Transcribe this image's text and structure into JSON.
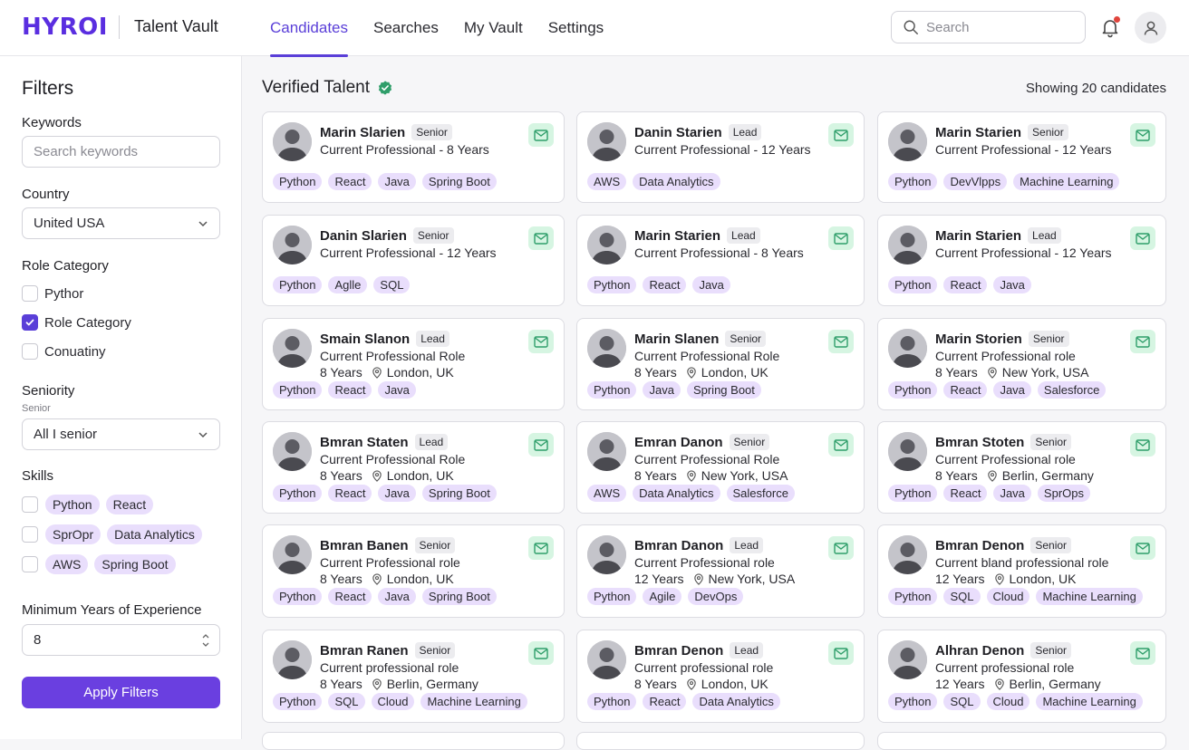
{
  "header": {
    "logo": "HYROI",
    "app_title": "Talent Vault",
    "tabs": [
      {
        "label": "Candidates",
        "active": true
      },
      {
        "label": "Searches",
        "active": false
      },
      {
        "label": "My Vault",
        "active": false
      },
      {
        "label": "Settings",
        "active": false
      }
    ],
    "search_placeholder": "Search",
    "icons": {
      "search": "search-icon",
      "bell": "bell-icon",
      "user": "user-icon"
    },
    "accent_color": "#5a3fd8",
    "notification_dot_color": "#e0443c"
  },
  "filters": {
    "title": "Filters",
    "keywords_label": "Keywords",
    "keywords_placeholder": "Search keywords",
    "country_label": "Country",
    "country_value": "United USA",
    "role_category_label": "Role Category",
    "role_options": [
      {
        "label": "Pythor",
        "checked": false
      },
      {
        "label": "Role Category",
        "checked": true
      },
      {
        "label": "Conuatiny",
        "checked": false
      }
    ],
    "seniority_label": "Seniority",
    "seniority_sublabel": "Senior",
    "seniority_value": "All I senior",
    "skills_label": "Skills",
    "skill_rows": [
      {
        "checked": false,
        "tags": [
          "Python",
          "React"
        ]
      },
      {
        "checked": false,
        "tags": [
          "SprOpr",
          "Data Analytics"
        ]
      },
      {
        "checked": false,
        "tags": [
          "AWS",
          "Spring Boot"
        ]
      }
    ],
    "min_years_label": "Minimum Years of Experience",
    "min_years_value": "8",
    "apply_label": "Apply Filters",
    "button_color": "#6a3fe0"
  },
  "main": {
    "title": "Verified Talent",
    "verified_color": "#2f9e6a",
    "count_text": "Showing 20 candidates",
    "tag_color": "#e9defc",
    "mail_bg_color": "#d6f5e2",
    "candidates": [
      {
        "name": "Marin Slarien",
        "level": "Senior",
        "role": "Current Professional  - 8 Years",
        "years": "",
        "location": "",
        "tags": [
          "Python",
          "React",
          "Java",
          "Spring Boot"
        ]
      },
      {
        "name": "Danin Starien",
        "level": "Lead",
        "role": "Current Professional - 12 Years",
        "years": "",
        "location": "",
        "tags": [
          "AWS",
          "Data Analytics"
        ]
      },
      {
        "name": "Marin Starien",
        "level": "Senior",
        "role": "Current Professional - 12 Years",
        "years": "",
        "location": "",
        "tags": [
          "Python",
          "DevVlpps",
          "Machine Learning"
        ]
      },
      {
        "name": "Danin Slarien",
        "level": "Senior",
        "role": "Current Professional - 12 Years",
        "years": "",
        "location": "",
        "tags": [
          "Python",
          "Aglle",
          "SQL"
        ]
      },
      {
        "name": "Marin Starien",
        "level": "Lead",
        "role": "Current Professional - 8 Years",
        "years": "",
        "location": "",
        "tags": [
          "Python",
          "React",
          "Java"
        ]
      },
      {
        "name": "Marin Starien",
        "level": "Lead",
        "role": "Current Professional - 12 Years",
        "years": "",
        "location": "",
        "tags": [
          "Python",
          "React",
          "Java"
        ]
      },
      {
        "name": "Smain Slanon",
        "level": "Lead",
        "role": "Current Professional Role",
        "years": "8 Years",
        "location": "London, UK",
        "tags": [
          "Python",
          "React",
          "Java"
        ]
      },
      {
        "name": "Marin Slanen",
        "level": "Senior",
        "role": "Current Professional Role",
        "years": "8 Years",
        "location": "London, UK",
        "tags": [
          "Python",
          "Java",
          "Spring Boot"
        ]
      },
      {
        "name": "Marin Storien",
        "level": "Senior",
        "role": "Current Professional role",
        "years": "8 Years",
        "location": "New York, USA",
        "tags": [
          "Python",
          "React",
          "Java",
          "Salesforce"
        ]
      },
      {
        "name": "Bmran Staten",
        "level": "Lead",
        "role": "Current Professional Role",
        "years": "8 Years",
        "location": "London, UK",
        "tags": [
          "Python",
          "React",
          "Java",
          "Spring Boot"
        ]
      },
      {
        "name": "Emran Danon",
        "level": "Senior",
        "role": "Current Professional Role",
        "years": "8 Years",
        "location": "New York, USA",
        "tags": [
          "AWS",
          "Data Analytics",
          "Salesforce"
        ]
      },
      {
        "name": "Bmran Stoten",
        "level": "Senior",
        "role": "Current Professional role",
        "years": "8 Years",
        "location": "Berlin, Germany",
        "tags": [
          "Python",
          "React",
          "Java",
          "SprOps"
        ]
      },
      {
        "name": "Bmran Banen",
        "level": "Senior",
        "role": "Current Professional role",
        "years": "8 Years",
        "location": "London, UK",
        "tags": [
          "Python",
          "React",
          "Java",
          "Spring Boot"
        ]
      },
      {
        "name": "Bmran Danon",
        "level": "Lead",
        "role": "Current Professional role",
        "years": "12 Years",
        "location": "New York, USA",
        "tags": [
          "Python",
          "Agile",
          "DevOps"
        ]
      },
      {
        "name": "Bmran Denon",
        "level": "Senior",
        "role": "Current bland professional role",
        "years": "12 Years",
        "location": "London, UK",
        "tags": [
          "Python",
          "SQL",
          "Cloud",
          "Machine Learning"
        ]
      },
      {
        "name": "Bmran Ranen",
        "level": "Senior",
        "role": "Current professional role",
        "years": "8 Years",
        "location": "Berlin, Germany",
        "tags": [
          "Python",
          "SQL",
          "Cloud",
          "Machine Learning"
        ]
      },
      {
        "name": "Bmran Denon",
        "level": "Lead",
        "role": "Current professional role",
        "years": "8 Years",
        "location": "London, UK",
        "tags": [
          "Python",
          "React",
          "Data Analytics"
        ]
      },
      {
        "name": "Alhran Denon",
        "level": "Senior",
        "role": "Current professional role",
        "years": "12 Years",
        "location": "Berlin, Germany",
        "tags": [
          "Python",
          "SQL",
          "Cloud",
          "Machine Learning"
        ]
      }
    ]
  }
}
